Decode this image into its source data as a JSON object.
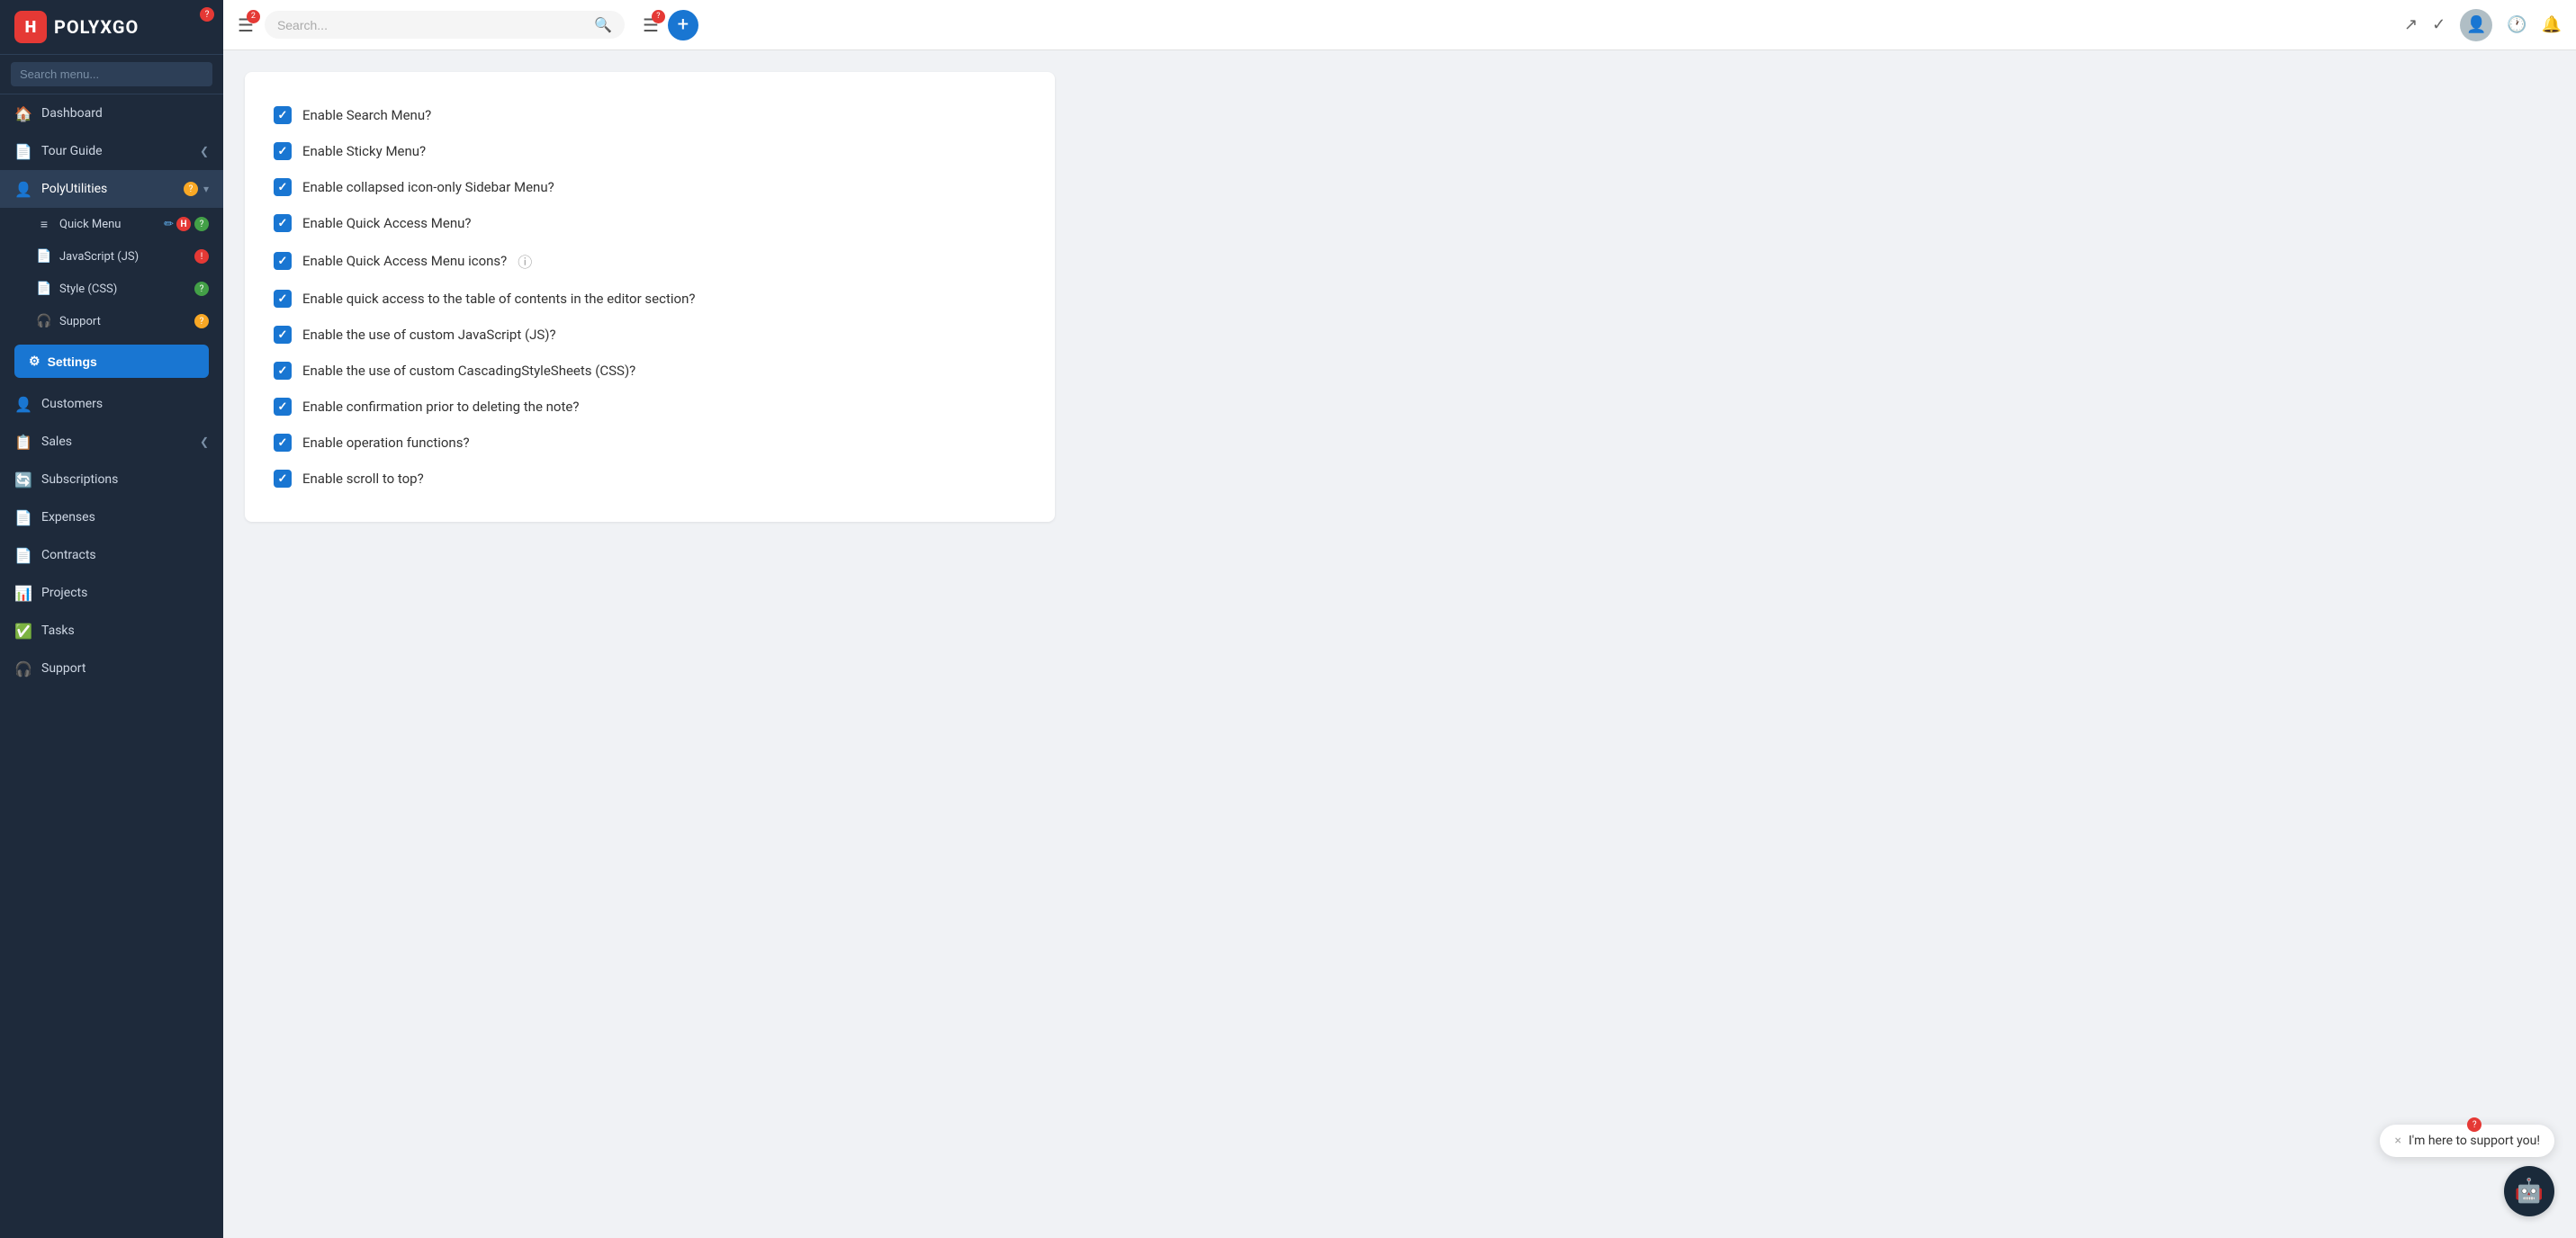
{
  "app": {
    "name": "POLYXGO",
    "logo_letter": "H"
  },
  "sidebar": {
    "search_placeholder": "Search menu...",
    "nav_items": [
      {
        "id": "dashboard",
        "label": "Dashboard",
        "icon": "🏠",
        "badge": null
      },
      {
        "id": "tour-guide",
        "label": "Tour Guide",
        "icon": "📄",
        "badge": null,
        "arrow": true
      },
      {
        "id": "polyutilities",
        "label": "PolyUtilities",
        "icon": "👤",
        "badge": "?",
        "badge_type": "yellow",
        "expanded": true,
        "arrow": "down"
      },
      {
        "id": "customers",
        "label": "Customers",
        "icon": "👤",
        "badge": null
      },
      {
        "id": "sales",
        "label": "Sales",
        "icon": "📋",
        "badge": null,
        "arrow": true
      },
      {
        "id": "subscriptions",
        "label": "Subscriptions",
        "icon": "🔄",
        "badge": null
      },
      {
        "id": "expenses",
        "label": "Expenses",
        "icon": "📄",
        "badge": null
      },
      {
        "id": "contracts",
        "label": "Contracts",
        "icon": "📄",
        "badge": null
      },
      {
        "id": "projects",
        "label": "Projects",
        "icon": "📊",
        "badge": null
      },
      {
        "id": "tasks",
        "label": "Tasks",
        "icon": "✅",
        "badge": null
      },
      {
        "id": "support",
        "label": "Support",
        "icon": "🎧",
        "badge": null
      }
    ],
    "subnav_items": [
      {
        "id": "quick-menu",
        "label": "Quick Menu",
        "icon": "≡",
        "badge": "?",
        "badge_type": "green"
      },
      {
        "id": "javascript",
        "label": "JavaScript (JS)",
        "icon": "📄",
        "badge": "!",
        "badge_type": "red"
      },
      {
        "id": "style-css",
        "label": "Style (CSS)",
        "icon": "📄",
        "badge": "?",
        "badge_type": "green"
      },
      {
        "id": "support-sub",
        "label": "Support",
        "icon": "🎧",
        "badge": "?",
        "badge_type": "yellow"
      }
    ],
    "settings_btn": "Settings"
  },
  "topbar": {
    "search_placeholder": "Search...",
    "menu_badge": "2",
    "menu2_badge": "?"
  },
  "settings": {
    "checkboxes": [
      {
        "id": "search-menu",
        "label": "Enable Search Menu?",
        "checked": true
      },
      {
        "id": "sticky-menu",
        "label": "Enable Sticky Menu?",
        "checked": true
      },
      {
        "id": "collapsed-sidebar",
        "label": "Enable collapsed icon-only Sidebar Menu?",
        "checked": true
      },
      {
        "id": "quick-access",
        "label": "Enable Quick Access Menu?",
        "checked": true
      },
      {
        "id": "quick-access-icons",
        "label": "Enable Quick Access Menu icons?",
        "checked": true,
        "has_help": true
      },
      {
        "id": "toc-editor",
        "label": "Enable quick access to the table of contents in the editor section?",
        "checked": true
      },
      {
        "id": "custom-js",
        "label": "Enable the use of custom JavaScript (JS)?",
        "checked": true
      },
      {
        "id": "custom-css",
        "label": "Enable the use of custom CascadingStyleSheets (CSS)?",
        "checked": true
      },
      {
        "id": "confirm-delete",
        "label": "Enable confirmation prior to deleting the note?",
        "checked": true
      },
      {
        "id": "operation-funcs",
        "label": "Enable operation functions?",
        "checked": true
      },
      {
        "id": "scroll-top",
        "label": "Enable scroll to top?",
        "checked": true
      }
    ]
  },
  "chat": {
    "bubble_text": "I'm here to support you!",
    "close_label": "×"
  }
}
